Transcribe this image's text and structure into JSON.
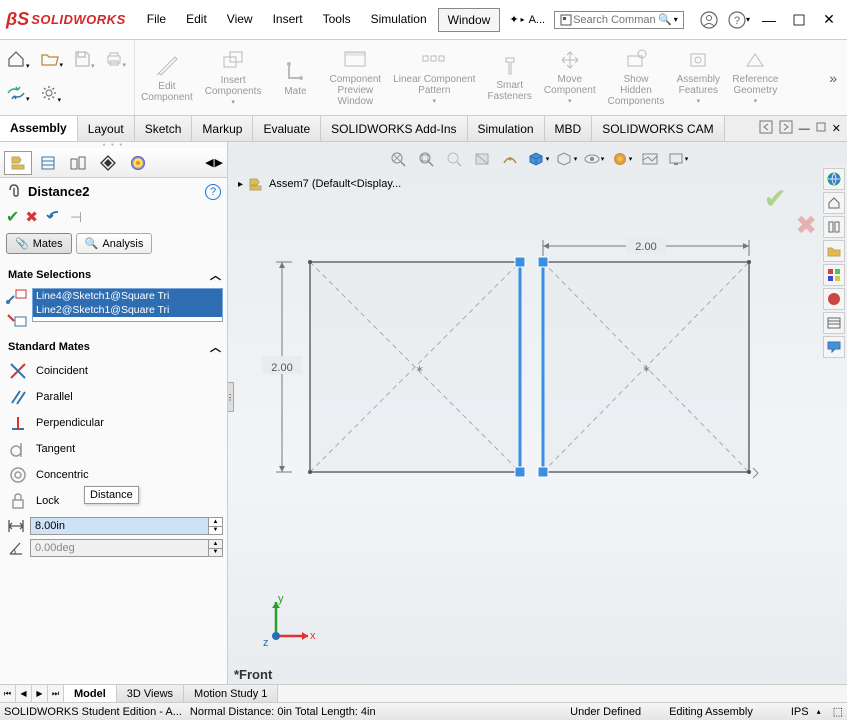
{
  "app": {
    "name": "SOLIDWORKS"
  },
  "menu": {
    "items": [
      "File",
      "Edit",
      "View",
      "Insert",
      "Tools",
      "Simulation",
      "Window"
    ],
    "active": "Window",
    "extra": "A..."
  },
  "search": {
    "placeholder": "Search Comman"
  },
  "ribbon": {
    "groups": [
      {
        "line1": "Edit",
        "line2": "Component"
      },
      {
        "line1": "Insert",
        "line2": "Components"
      },
      {
        "line1": "Mate",
        "line2": ""
      },
      {
        "line1": "Component",
        "line2": "Preview",
        "line3": "Window"
      },
      {
        "line1": "Linear Component",
        "line2": "Pattern"
      },
      {
        "line1": "Smart",
        "line2": "Fasteners"
      },
      {
        "line1": "Move",
        "line2": "Component"
      },
      {
        "line1": "Show",
        "line2": "Hidden",
        "line3": "Components"
      },
      {
        "line1": "Assembly",
        "line2": "Features"
      },
      {
        "line1": "Reference",
        "line2": "Geometry"
      }
    ]
  },
  "tabs": {
    "items": [
      "Assembly",
      "Layout",
      "Sketch",
      "Markup",
      "Evaluate",
      "SOLIDWORKS Add-Ins",
      "Simulation",
      "MBD",
      "SOLIDWORKS CAM"
    ],
    "active": "Assembly"
  },
  "panel": {
    "title": "Distance2",
    "subtabs": {
      "mates": "Mates",
      "analysis": "Analysis"
    },
    "sections": {
      "selections": "Mate Selections",
      "standard": "Standard Mates"
    },
    "selections": [
      "Line4@Sketch1@Square Tri",
      "Line2@Sketch1@Square Tri"
    ],
    "mates": {
      "coincident": "Coincident",
      "parallel": "Parallel",
      "perpendicular": "Perpendicular",
      "tangent": "Tangent",
      "concentric": "Concentric",
      "lock": "Lock"
    },
    "tooltip": "Distance",
    "distance": "8.00in",
    "angle": "0.00deg"
  },
  "canvas": {
    "doc_name": "Assem7  (Default<Display...",
    "dim1": "2.00",
    "dim2": "2.00",
    "triad": {
      "x": "x",
      "y": "y",
      "z": "z"
    },
    "view_name": "*Front"
  },
  "bottom_tabs": {
    "items": [
      "Model",
      "3D Views",
      "Motion Study 1"
    ],
    "active": "Model"
  },
  "status": {
    "edition": "SOLIDWORKS Student Edition - A...",
    "info": "Normal Distance: 0in Total Length: 4in",
    "defined": "Under Defined",
    "mode": "Editing Assembly",
    "units": "IPS"
  }
}
